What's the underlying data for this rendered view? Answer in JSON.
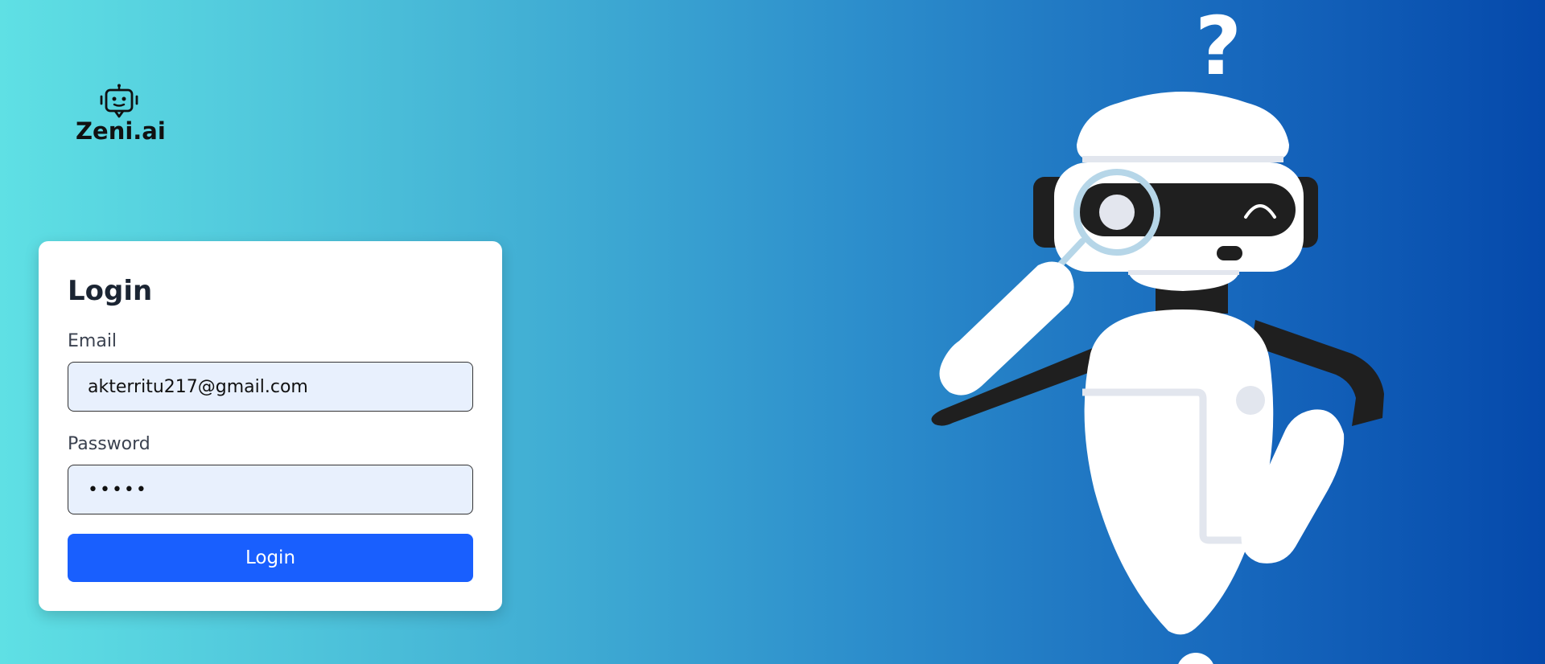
{
  "brand": {
    "name": "Zeni.ai",
    "logo_icon": "robot-chat-icon"
  },
  "login_form": {
    "title": "Login",
    "email_label": "Email",
    "email_value": "akterritu217@gmail.com",
    "password_label": "Password",
    "password_value": "•••••",
    "submit_label": "Login"
  },
  "illustration": {
    "subject": "robot-with-magnifier-icon",
    "question_mark": "?"
  },
  "colors": {
    "gradient_start": "#5fe0e4",
    "gradient_end": "#0549ab",
    "button": "#195ffe",
    "input_bg": "#e8f0fd"
  }
}
